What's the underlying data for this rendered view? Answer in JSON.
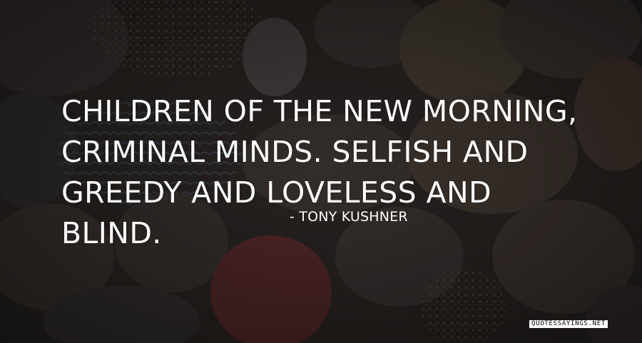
{
  "quote": {
    "text": "Children of the new morning, criminal minds. Selfish and greedy and loveless and blind."
  },
  "author": {
    "text": "- Tony Kushner"
  },
  "watermark": {
    "text": "QUOTESSAYINGS.NET"
  },
  "colors": {
    "background": "#2b2725",
    "text": "#ffffff",
    "watermark_bg": "#ffffff",
    "watermark_text": "#000000"
  },
  "background": {
    "subject": "dark pebbles and seashells",
    "icon": "seashells-background"
  }
}
